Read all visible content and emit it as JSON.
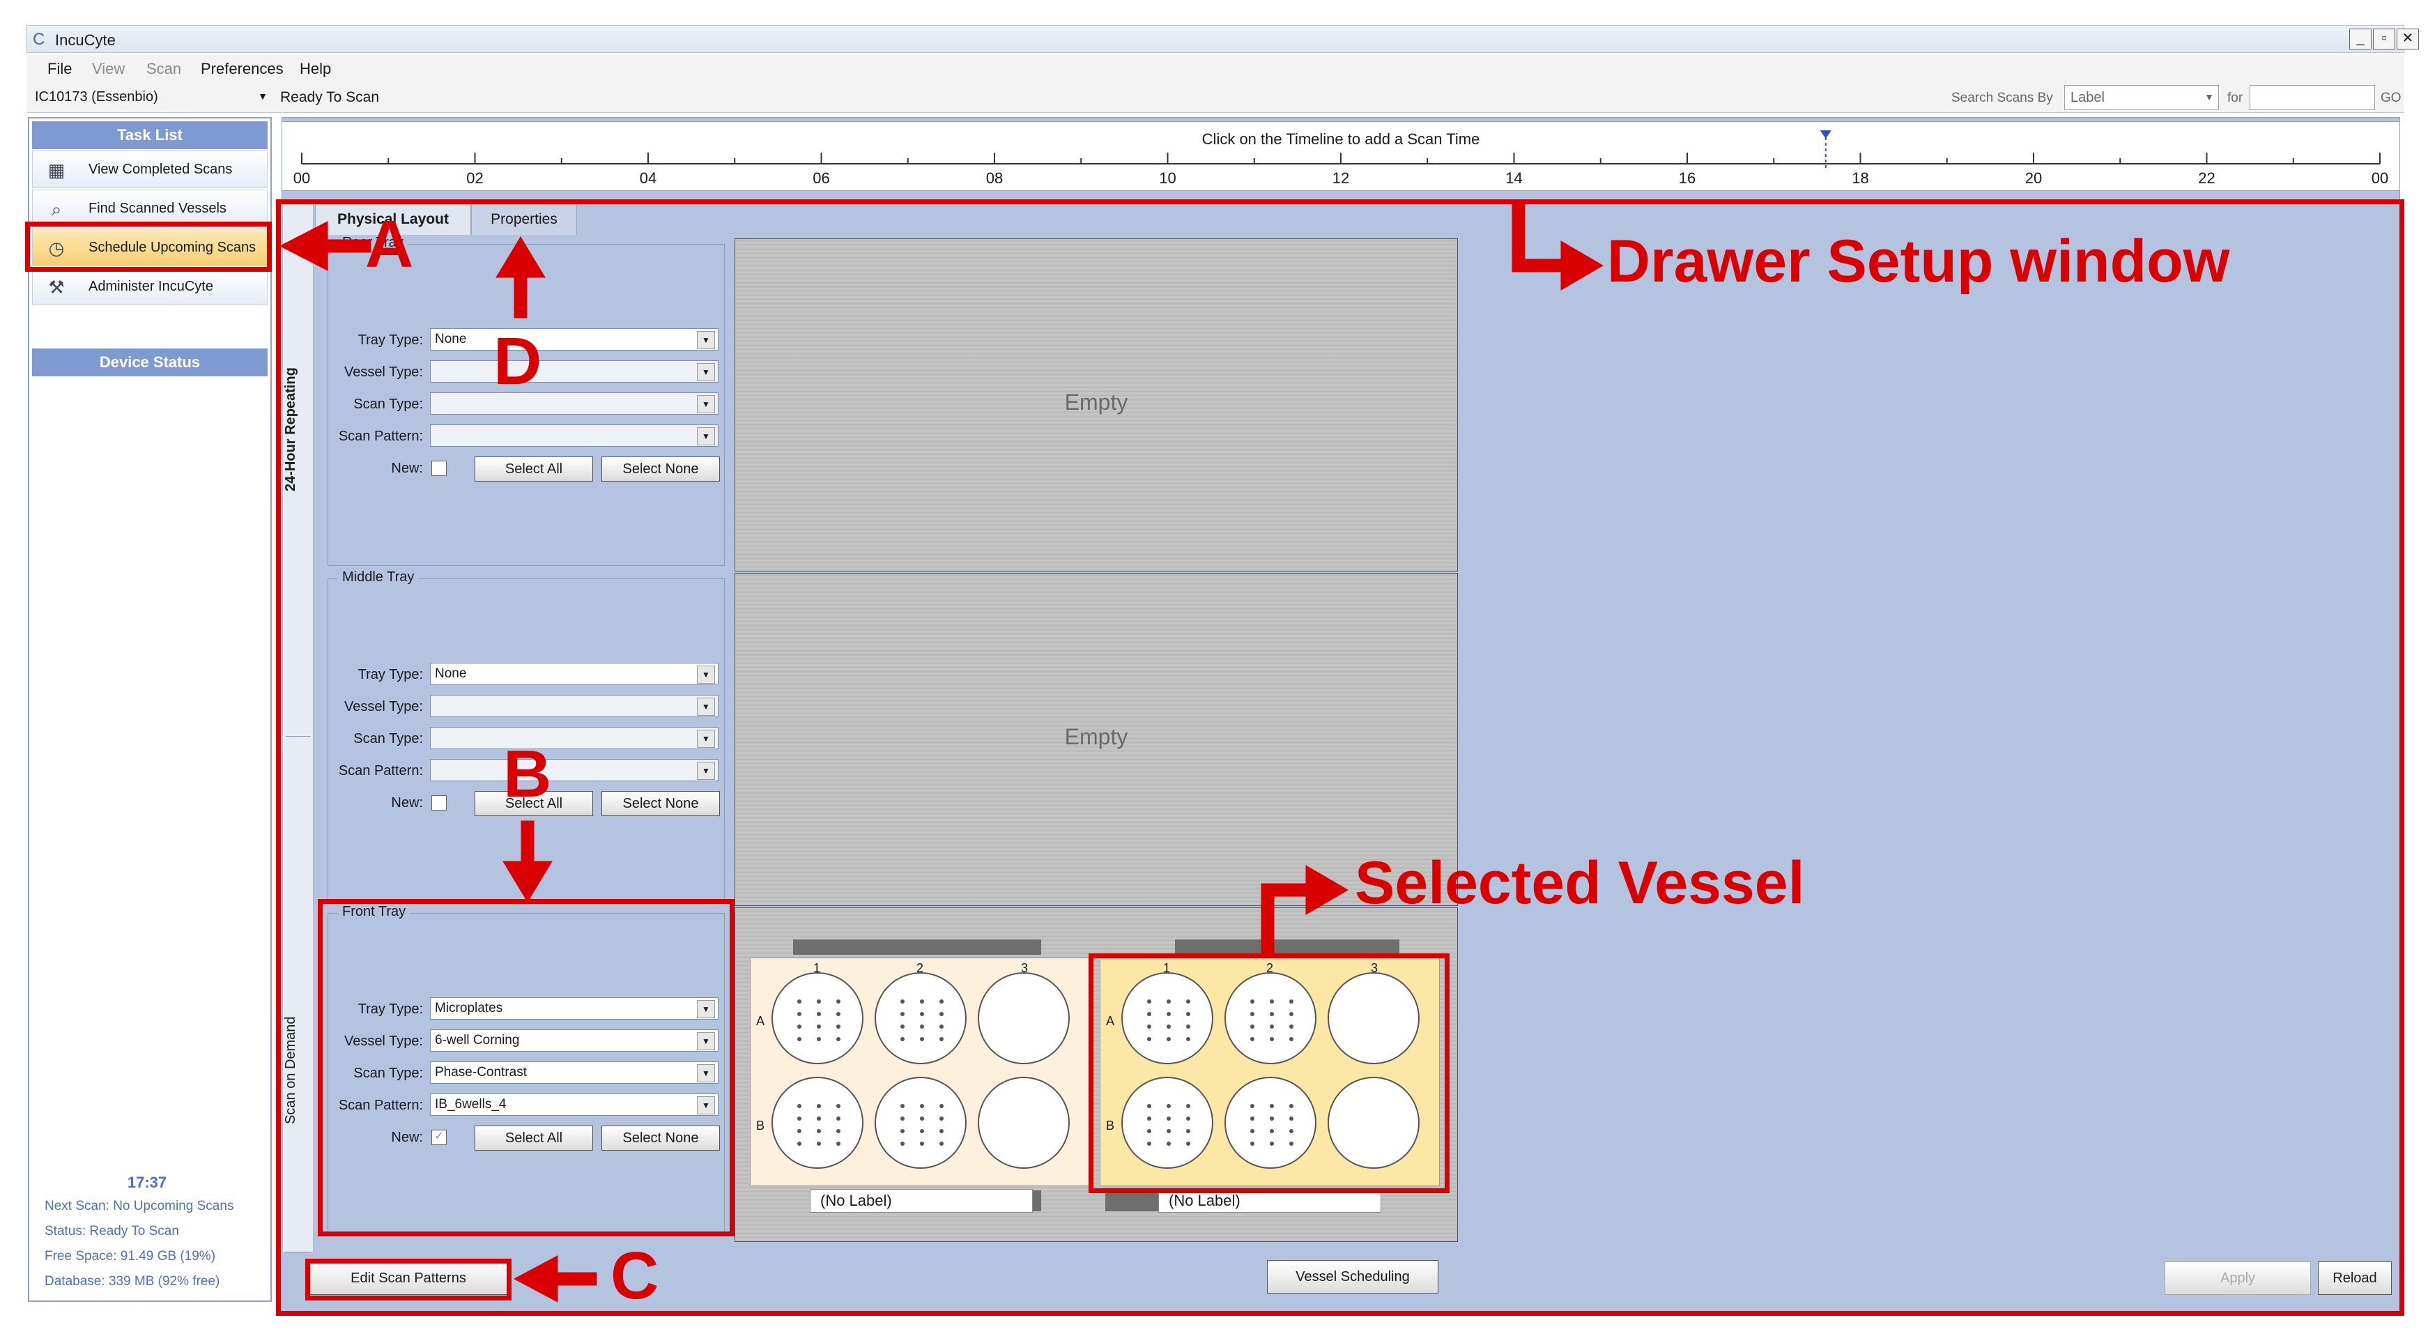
{
  "window": {
    "title": "IncuCyte"
  },
  "menu": [
    "File",
    "View",
    "Scan",
    "Preferences",
    "Help"
  ],
  "toolbar": {
    "device": "IC10173 (Essenbio)",
    "status": "Ready To Scan",
    "search_label": "Search Scans By",
    "search_by": "Label",
    "for_label": "for",
    "for_value": "",
    "go_label": "GO"
  },
  "sidebar": {
    "task_list_title": "Task List",
    "items": [
      {
        "label": "View Completed Scans",
        "icon": "completed-scans-icon"
      },
      {
        "label": "Find Scanned Vessels",
        "icon": "find-vessels-icon"
      },
      {
        "label": "Schedule Upcoming Scans",
        "icon": "clock-icon",
        "selected": true
      },
      {
        "label": "Administer IncuCyte",
        "icon": "tools-icon"
      }
    ],
    "device_status_title": "Device Status",
    "time": "17:37",
    "next_scan": "Next Scan: No Upcoming Scans",
    "status": "Status: Ready To Scan",
    "free_space": "Free Space: 91.49 GB (19%)",
    "database": "Database: 339 MB (92% free)"
  },
  "timeline": {
    "hint": "Click on the Timeline to add a Scan Time",
    "hours": [
      "00",
      "02",
      "04",
      "06",
      "08",
      "10",
      "12",
      "14",
      "16",
      "18",
      "20",
      "22",
      "00"
    ],
    "current_hour": 17.6
  },
  "side_labels": {
    "repeating": "24-Hour Repeating",
    "on_demand": "Scan on Demand"
  },
  "tabs": [
    {
      "label": "Physical Layout",
      "active": true
    },
    {
      "label": "Properties",
      "active": false
    }
  ],
  "field_labels": {
    "tray_type": "Tray Type:",
    "vessel_type": "Vessel Type:",
    "scan_type": "Scan Type:",
    "scan_pattern": "Scan Pattern:",
    "new": "New:"
  },
  "buttons": {
    "select_all": "Select All",
    "select_none": "Select None",
    "edit_scan_patterns": "Edit Scan Patterns",
    "vessel_scheduling": "Vessel Scheduling",
    "apply": "Apply",
    "reload": "Reload"
  },
  "trays": {
    "rear": {
      "title": "Rear Tray",
      "tray_type": "None",
      "vessel_type": "",
      "scan_type": "",
      "scan_pattern": "",
      "new": false,
      "view": "Empty"
    },
    "middle": {
      "title": "Middle Tray",
      "tray_type": "None",
      "vessel_type": "",
      "scan_type": "",
      "scan_pattern": "",
      "new": false,
      "view": "Empty"
    },
    "front": {
      "title": "Front Tray",
      "tray_type": "Microplates",
      "vessel_type": "6-well Corning",
      "scan_type": "Phase-Contrast",
      "scan_pattern": "IB_6wells_4",
      "new": true
    }
  },
  "plates": [
    {
      "label": "(No Label)",
      "columns": [
        "1",
        "2",
        "3"
      ],
      "rows": [
        "A",
        "B"
      ],
      "selected": false
    },
    {
      "label": "(No Label)",
      "columns": [
        "1",
        "2",
        "3"
      ],
      "rows": [
        "A",
        "B"
      ],
      "selected": true
    }
  ],
  "annotations": {
    "a": "A",
    "b": "B",
    "c": "C",
    "d": "D",
    "drawer": "Drawer Setup window",
    "selected": "Selected Vessel"
  },
  "colors": {
    "accent": "#7f9ad1",
    "panel": "#b4c4e0",
    "annotation": "#d90000",
    "selected_plate": "#fbe7a6",
    "plate": "#fdf0dc"
  }
}
